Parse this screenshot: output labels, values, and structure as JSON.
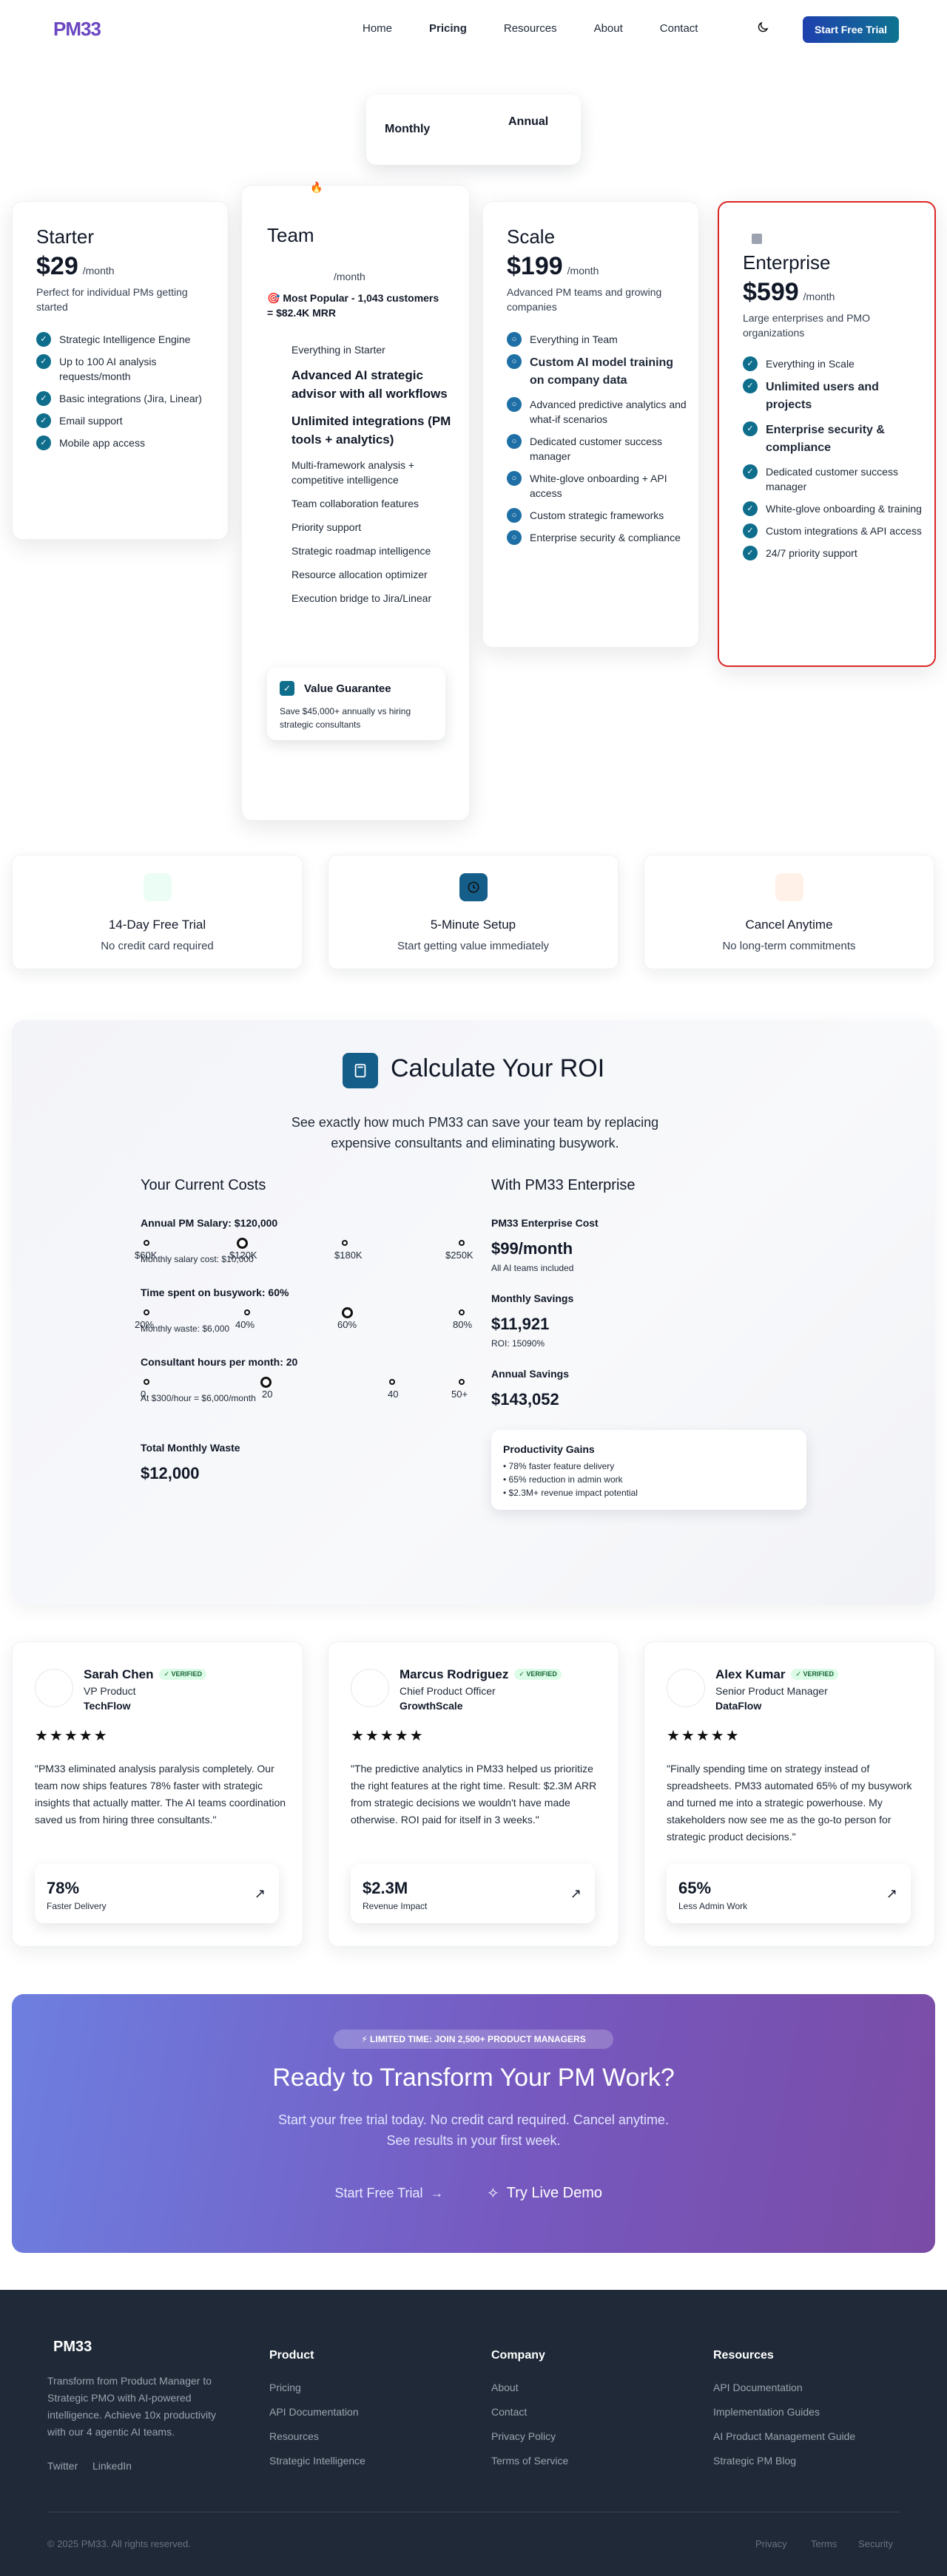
{
  "nav": {
    "logo": "PM33",
    "links": [
      "Home",
      "Pricing",
      "Resources",
      "About",
      "Contact"
    ],
    "cta": "Start Free Trial"
  },
  "billing_toggle": {
    "monthly": "Monthly",
    "annual": "Annual"
  },
  "plans": {
    "starter": {
      "name": "Starter",
      "price": "$29",
      "per": "/month",
      "desc": "Perfect for individual PMs getting started",
      "features": [
        "Strategic Intelligence Engine",
        "Up to 100 AI analysis requests/month",
        "Basic integrations (Jira, Linear)",
        "Email support",
        "Mobile app access"
      ]
    },
    "team": {
      "name": "Team",
      "per": "/month",
      "popular": "Most Popular - 1,043 customers = $82.4K MRR",
      "features": [
        "Everything in Starter",
        "Advanced AI strategic advisor with all workflows",
        "Unlimited integrations (PM tools + analytics)",
        "Multi-framework analysis + competitive intelligence",
        "Team collaboration features",
        "Priority support",
        "Strategic roadmap intelligence",
        "Resource allocation optimizer",
        "Execution bridge to Jira/Linear"
      ],
      "guarantee_title": "Value Guarantee",
      "guarantee_text": "Save $45,000+ annually vs hiring strategic consultants"
    },
    "scale": {
      "name": "Scale",
      "price": "$199",
      "per": "/month",
      "desc": "Advanced PM teams and growing companies",
      "features": [
        "Everything in Team",
        "Custom AI model training on company data",
        "Advanced predictive analytics and what-if scenarios",
        "Dedicated customer success manager",
        "White-glove onboarding + API access",
        "Custom strategic frameworks",
        "Enterprise security & compliance"
      ]
    },
    "enterprise": {
      "name": "Enterprise",
      "price": "$599",
      "per": "/month",
      "desc": "Large enterprises and PMO organizations",
      "features": [
        "Everything in Scale",
        "Unlimited users and projects",
        "Enterprise security & compliance",
        "Dedicated customer success manager",
        "White-glove onboarding & training",
        "Custom integrations & API access",
        "24/7 priority support"
      ]
    }
  },
  "trust": [
    {
      "title": "14-Day Free Trial",
      "sub": "No credit card required"
    },
    {
      "title": "5-Minute Setup",
      "sub": "Start getting value immediately"
    },
    {
      "title": "Cancel Anytime",
      "sub": "No long-term commitments"
    }
  ],
  "roi": {
    "title": "Calculate Your ROI",
    "subtitle": "See exactly how much PM33 can save your team by replacing expensive consultants and eliminating busywork.",
    "current_title": "Your Current Costs",
    "salary_label": "Annual PM Salary: $120,000",
    "salary_ticks": [
      "$60K",
      "$120K",
      "$180K",
      "$250K"
    ],
    "salary_note": "Monthly salary cost: $10,000",
    "busy_label": "Time spent on busywork: 60%",
    "busy_ticks": [
      "20%",
      "40%",
      "60%",
      "80%"
    ],
    "busy_note": "Monthly waste: $6,000",
    "consult_label": "Consultant hours per month: 20",
    "consult_ticks": [
      "0",
      "20",
      "40",
      "50+"
    ],
    "consult_note": "At $300/hour = $6,000/month",
    "total_label": "Total Monthly Waste",
    "total_value": "$12,000",
    "with_title": "With PM33 Enterprise",
    "cost_label": "PM33 Enterprise Cost",
    "cost_value": "$99/month",
    "cost_note": "All AI teams included",
    "savings_label": "Monthly Savings",
    "savings_value": "$11,921",
    "savings_note": "ROI: 15090%",
    "annual_label": "Annual Savings",
    "annual_value": "$143,052",
    "gains_title": "Productivity Gains",
    "gains": [
      "• 78% faster feature delivery",
      "• 65% reduction in admin work",
      "• $2.3M+ revenue impact potential"
    ]
  },
  "testimonials": [
    {
      "name": "Sarah Chen",
      "badge": "✓ VERIFIED",
      "role": "VP Product",
      "company": "TechFlow",
      "stars": "★★★★★",
      "quote": "\"PM33 eliminated analysis paralysis completely. Our team now ships features 78% faster with strategic insights that actually matter. The AI teams coordination saved us from hiring three consultants.\"",
      "stat_value": "78%",
      "stat_label": "Faster Delivery"
    },
    {
      "name": "Marcus Rodriguez",
      "badge": "✓ VERIFIED",
      "role": "Chief Product Officer",
      "company": "GrowthScale",
      "stars": "★★★★★",
      "quote": "\"The predictive analytics in PM33 helped us prioritize the right features at the right time. Result: $2.3M ARR from strategic decisions we wouldn't have made otherwise. ROI paid for itself in 3 weeks.\"",
      "stat_value": "$2.3M",
      "stat_label": "Revenue Impact"
    },
    {
      "name": "Alex Kumar",
      "badge": "✓ VERIFIED",
      "role": "Senior Product Manager",
      "company": "DataFlow",
      "stars": "★★★★★",
      "quote": "\"Finally spending time on strategy instead of spreadsheets. PM33 automated 65% of my busywork and turned me into a strategic powerhouse. My stakeholders now see me as the go-to person for strategic product decisions.\"",
      "stat_value": "65%",
      "stat_label": "Less Admin Work"
    }
  ],
  "cta": {
    "badge": "⚡ LIMITED TIME: JOIN 2,500+ PRODUCT MANAGERS",
    "title": "Ready to Transform Your PM Work?",
    "sub1": "Start your free trial today. No credit card required. Cancel anytime.",
    "sub2": "See results in your first week.",
    "primary": "Start Free Trial",
    "secondary": "Try Live Demo"
  },
  "footer": {
    "logo": "PM33",
    "tagline": "Transform from Product Manager to Strategic PMO with AI-powered intelligence. Achieve 10x productivity with our 4 agentic AI teams.",
    "social": [
      "Twitter",
      "LinkedIn"
    ],
    "cols": [
      {
        "title": "Product",
        "links": [
          "Pricing",
          "API Documentation",
          "Resources",
          "Strategic Intelligence"
        ]
      },
      {
        "title": "Company",
        "links": [
          "About",
          "Contact",
          "Privacy Policy",
          "Terms of Service"
        ]
      },
      {
        "title": "Resources",
        "links": [
          "API Documentation",
          "Implementation Guides",
          "AI Product Management Guide",
          "Strategic PM Blog"
        ]
      }
    ],
    "copyright": "© 2025 PM33. All rights reserved.",
    "legal": [
      "Privacy",
      "Terms",
      "Security"
    ]
  },
  "colors": {
    "brand_blue": "#1e40af",
    "brand_teal": "#0e7490",
    "enterprise_border": "#dc2626",
    "footer_bg": "#1f2937"
  }
}
